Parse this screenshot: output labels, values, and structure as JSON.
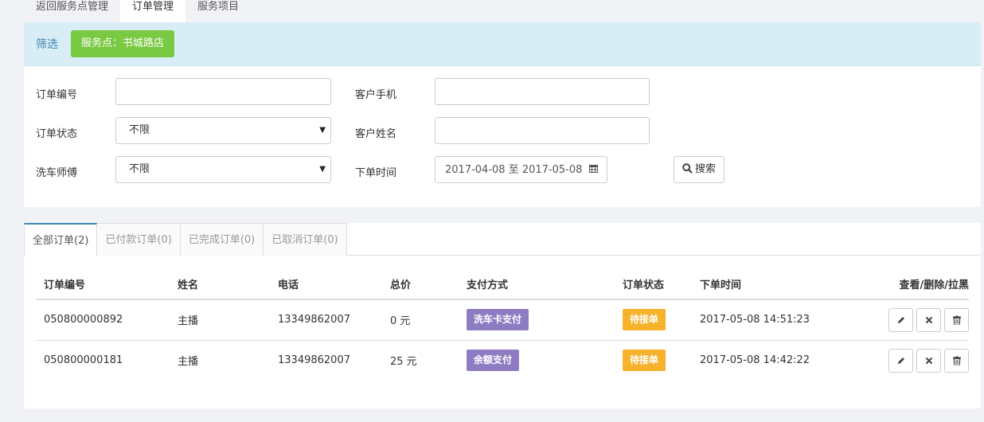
{
  "topnav": {
    "tabs": [
      {
        "label": "返回服务点管理",
        "active": false
      },
      {
        "label": "订单管理",
        "active": true
      },
      {
        "label": "服务项目",
        "active": false
      }
    ]
  },
  "filter": {
    "title": "筛选",
    "store_button": "服务点：书城路店",
    "order_no_label": "订单编号",
    "order_no_value": "",
    "phone_label": "客户手机",
    "phone_value": "",
    "status_label": "订单状态",
    "status_value": "不限",
    "name_label": "客户姓名",
    "name_value": "",
    "washer_label": "洗车师傅",
    "washer_value": "不限",
    "time_label": "下单时间",
    "date_range": "2017-04-08 至 2017-05-08",
    "search_label": "搜索"
  },
  "order_tabs": [
    {
      "label": "全部订单(2)",
      "active": true
    },
    {
      "label": "已付款订单(0)",
      "active": false
    },
    {
      "label": "已完成订单(0)",
      "active": false
    },
    {
      "label": "已取消订单(0)",
      "active": false
    }
  ],
  "table": {
    "headers": {
      "order_no": "订单编号",
      "name": "姓名",
      "phone": "电话",
      "total": "总价",
      "pay_method": "支付方式",
      "status": "订单状态",
      "time": "下单时间",
      "ops": "查看/删除/拉黑"
    },
    "rows": [
      {
        "order_no": "050800000892",
        "name": "主播",
        "phone": "13349862007",
        "total": "0 元",
        "pay_method": "洗车卡支付",
        "status": "待接单",
        "time": "2017-05-08 14:51:23"
      },
      {
        "order_no": "050800000181",
        "name": "主播",
        "phone": "13349862007",
        "total": "25 元",
        "pay_method": "余额支付",
        "status": "待接单",
        "time": "2017-05-08 14:42:22"
      }
    ]
  },
  "colors": {
    "accent": "#3a87ad",
    "store_button": "#7ac943",
    "pay_badge": "#8e7cc3",
    "status_badge": "#f6b22b",
    "filter_header_bg": "#d9edf7"
  }
}
